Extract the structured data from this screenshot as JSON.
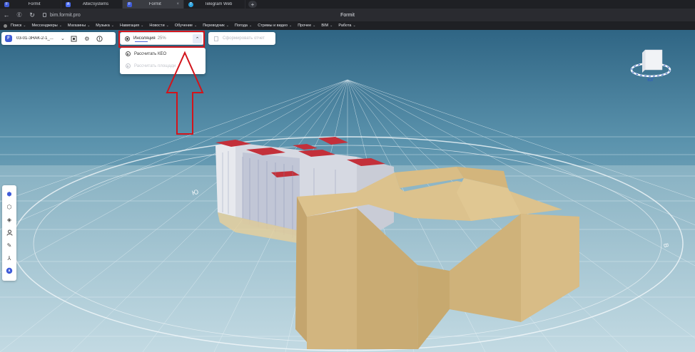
{
  "browser": {
    "tabs": [
      {
        "label": "Formit",
        "fav": "F",
        "fav_color": "#3f5bd6",
        "active": false
      },
      {
        "label": "AltecSystems",
        "fav": "A",
        "fav_color": "#4a6cf0",
        "active": false
      },
      {
        "label": "Formit",
        "fav": "F",
        "fav_color": "#3f5bd6",
        "active": true
      },
      {
        "label": "Telegram Web",
        "fav": "T",
        "fav_color": "#2aa3e0",
        "active": false
      }
    ],
    "new_tab": "+",
    "url": "bim.formit.pro",
    "page_title": "Formit",
    "bookmarks": [
      "Поиск",
      "Мессенджеры",
      "Магазины",
      "Музыка",
      "Навигация",
      "Новости",
      "Обучение",
      "Переводчик",
      "Погода",
      "Стримы и видео",
      "Прочее",
      "BIM",
      "Работа"
    ]
  },
  "app": {
    "logo": "F",
    "project_name": "03-01-ЗНАК-2-1_...",
    "insolation_label": "Инсоляция",
    "insolation_percent": "25%",
    "insolation_progress": 0.25,
    "report_label": "Сформировать отчет",
    "dropdown_items": [
      {
        "label": "Рассчитать КЕО",
        "disabled": false
      },
      {
        "label": "Рассчитать площади",
        "disabled": true
      }
    ],
    "accent": "#3f5bd6",
    "highlight_color": "#d2141b"
  },
  "navcube": {
    "label": "ЮГ"
  },
  "compass": {
    "labels": [
      "Ю",
      "В"
    ]
  }
}
